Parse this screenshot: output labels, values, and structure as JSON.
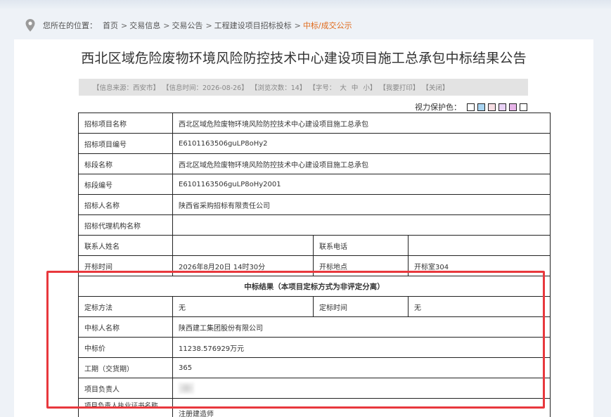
{
  "breadcrumb": {
    "prefix": "您所在的位置：",
    "items": [
      "首页",
      "交易信息",
      "交易公告",
      "工程建设项目招标投标"
    ],
    "current": "中标/成交公示"
  },
  "title": "西北区域危险废物环境风险防控技术中心建设项目施工总承包中标结果公告",
  "infobar": {
    "source": "【信息来源：西安市】",
    "time": "【信息时间：2026-08-26】",
    "views": "【浏览次数：14】",
    "font_open": "【字号：",
    "font_big": "大",
    "font_mid": "中",
    "font_small": "小",
    "font_close": "】",
    "print": "【我要打印】",
    "close": "【关闭】"
  },
  "vision": {
    "label": "视力保护色：",
    "colors": [
      "#ffffff",
      "#a9d4f1",
      "#f6dde3",
      "#e8d1f5",
      "#e6b4e8",
      "#ffffff"
    ]
  },
  "table": {
    "rows": [
      {
        "label": "招标项目名称",
        "value": "西北区域危险废物环境风险防控技术中心建设项目施工总承包"
      },
      {
        "label": "招标项目编号",
        "value": "E6101163506guLP8oHy2"
      },
      {
        "label": "标段名称",
        "value": "西北区域危险废物环境风险防控技术中心建设项目施工总承包"
      },
      {
        "label": "标段编号",
        "value": "E6101163506guLP8oHy2001"
      },
      {
        "label": "招标人名称",
        "value": "陕西省采购招标有限责任公司"
      },
      {
        "label": "招标代理机构名称",
        "value": ""
      }
    ],
    "contact": {
      "label": "联系人姓名",
      "value": "",
      "label2": "联系电话",
      "value2": ""
    },
    "opening": {
      "label": "开标时间",
      "value": "2026年8月20日 14时30分",
      "label2": "开标地点",
      "value2": "开标室304"
    },
    "result_header": "中标结果（本项目定标方式为非评定分离）",
    "method": {
      "label": "定标方法",
      "value": "无",
      "label2": "定标时间",
      "value2": "无"
    },
    "rows2": [
      {
        "label": "中标人名称",
        "value": "陕西建工集团股份有限公司"
      },
      {
        "label": "中标价",
        "value": "11238.576929万元"
      },
      {
        "label": "工期（交货期）",
        "value": "365"
      }
    ],
    "manager_label": "项目负责人",
    "cert": {
      "label": "项目负责人执业证书名称",
      "value": "注册建造师"
    }
  }
}
